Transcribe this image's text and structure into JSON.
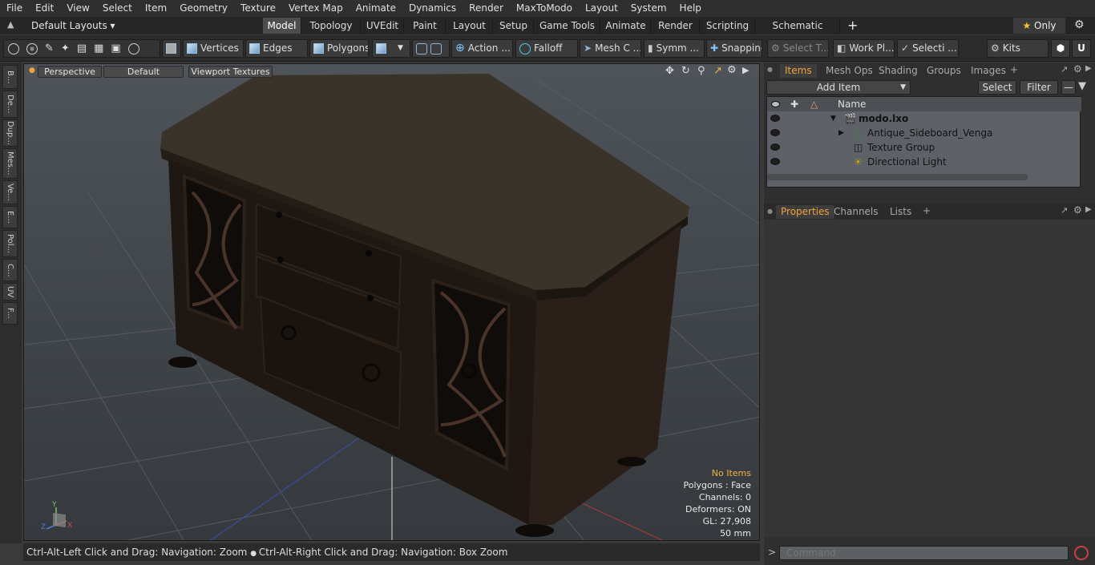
{
  "menu": [
    "File",
    "Edit",
    "View",
    "Select",
    "Item",
    "Geometry",
    "Texture",
    "Vertex Map",
    "Animate",
    "Dynamics",
    "Render",
    "MaxToModo",
    "Layout",
    "System",
    "Help"
  ],
  "layout_dropdown": "Default Layouts",
  "layout_tabs": [
    "Model",
    "Topology",
    "UVEdit",
    "Paint",
    "Layout",
    "Setup",
    "Game Tools",
    "Animate",
    "Render",
    "Scripting",
    "Schematic Fusion"
  ],
  "active_layout_tab": "Model",
  "only_label": "Only",
  "toolbar": {
    "vertices": "Vertices",
    "edges": "Edges",
    "polygons": "Polygons",
    "action": "Action",
    "falloff": "Falloff",
    "mesh_c": "Mesh C ...",
    "symm": "Symm ...",
    "snapping": "Snapping",
    "select_t": "Select T...",
    "work_pl": "Work Pl...",
    "selecti": "Selecti ...",
    "kits": "Kits"
  },
  "left_strip": [
    "B...",
    "De...",
    "Dup...",
    "Mes...",
    "Ve...",
    "E...",
    "Pol...",
    "C...",
    "UV",
    "F..."
  ],
  "viewport": {
    "perspective": "Perspective",
    "default": "Default",
    "textures": "Viewport Textures",
    "stats": {
      "no_items": "No Items",
      "polygons": "Polygons : Face",
      "channels": "Channels: 0",
      "deformers": "Deformers: ON",
      "gl": "GL: 27,908",
      "focal": "50 mm"
    }
  },
  "status_text_1": "Ctrl-Alt-Left Click and Drag: Navigation: Zoom",
  "status_text_2": "Ctrl-Alt-Right Click and Drag: Navigation: Box Zoom",
  "items_panel": {
    "tabs": [
      "Items",
      "Mesh Ops",
      "Shading",
      "Groups",
      "Images"
    ],
    "add_item": "Add Item",
    "select": "Select",
    "filter": "Filter",
    "name_col": "Name",
    "tree": [
      {
        "label": "modo.lxo",
        "bold": true
      },
      {
        "label": "Antique_Sideboard_Venga",
        "bold": false
      },
      {
        "label": "Texture Group",
        "bold": false
      },
      {
        "label": "Directional Light",
        "bold": false
      }
    ]
  },
  "props_panel": {
    "tabs": [
      "Properties",
      "Channels",
      "Lists"
    ]
  },
  "command_placeholder": "Command"
}
